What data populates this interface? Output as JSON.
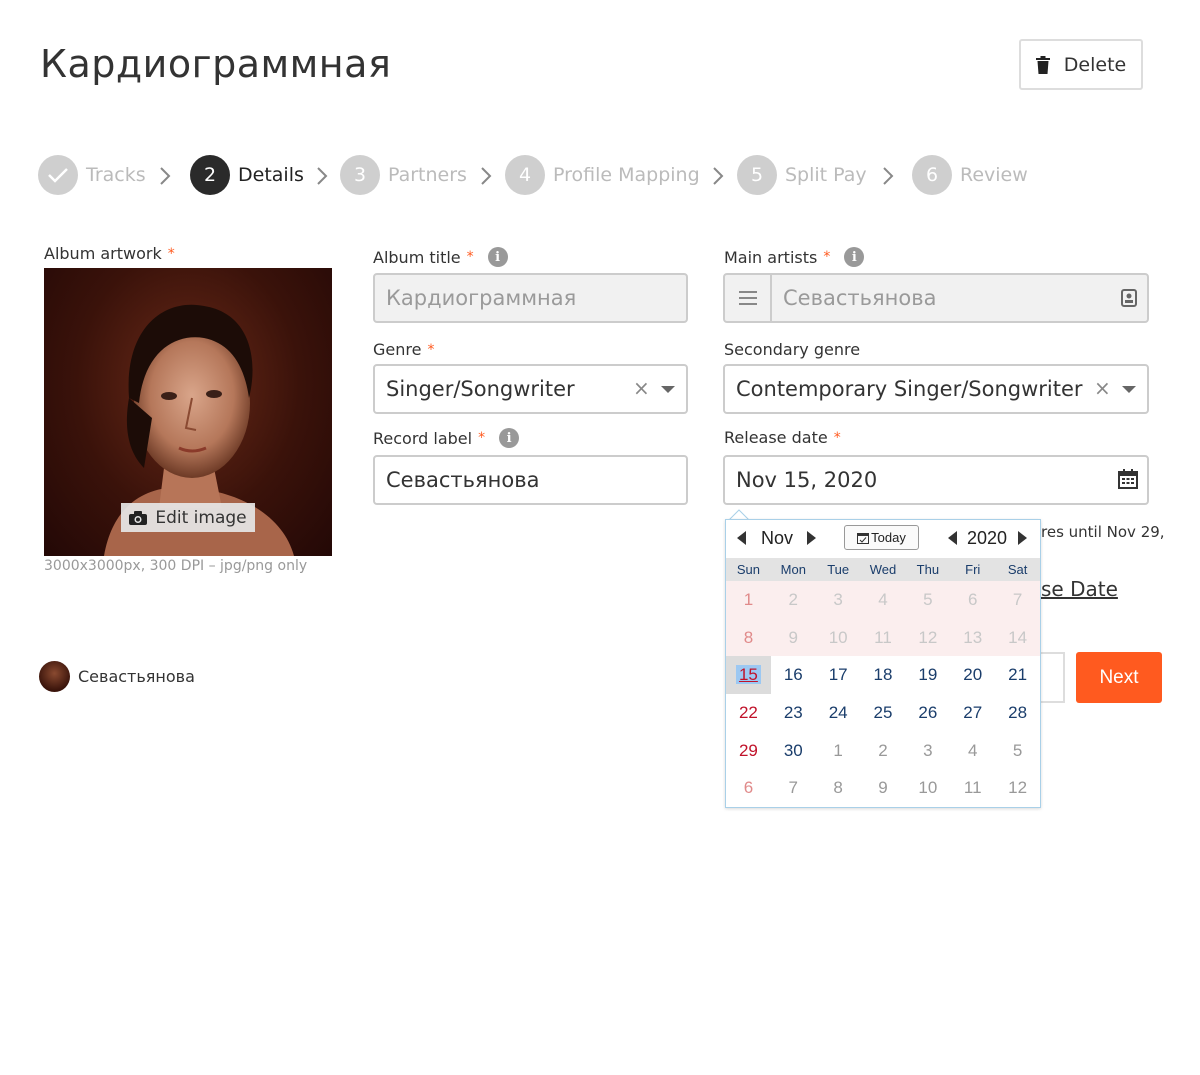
{
  "header": {
    "title": "Кардиограммная",
    "delete_label": "Delete"
  },
  "stepper": {
    "steps": [
      {
        "label": "Tracks",
        "number": "",
        "state": "done"
      },
      {
        "label": "Details",
        "number": "2",
        "state": "active"
      },
      {
        "label": "Partners",
        "number": "3",
        "state": "pending"
      },
      {
        "label": "Profile Mapping",
        "number": "4",
        "state": "pending"
      },
      {
        "label": "Split Pay",
        "number": "5",
        "state": "pending"
      },
      {
        "label": "Review",
        "number": "6",
        "state": "pending"
      }
    ]
  },
  "artwork": {
    "label": "Album artwork",
    "edit_label": "Edit image",
    "caption": "3000x3000px, 300 DPI – jpg/png only"
  },
  "form": {
    "album_title": {
      "label": "Album title",
      "value": "Кардиограммная"
    },
    "main_artists": {
      "label": "Main artists",
      "value": "Севастьянова"
    },
    "genre": {
      "label": "Genre",
      "value": "Singer/Songwriter"
    },
    "secondary_genre": {
      "label": "Secondary genre",
      "value": "Contemporary Singer/Songwriter"
    },
    "record_label": {
      "label": "Record label",
      "value": "Севастьянова"
    },
    "release_date": {
      "label": "Release date",
      "value": "Nov 15, 2020"
    }
  },
  "behind": {
    "note_fragment": "res until Nov 29,",
    "link_fragment": "se Date"
  },
  "actions": {
    "next_label": "Next"
  },
  "owner": {
    "name": "Севастьянова"
  },
  "calendar": {
    "month": "Nov",
    "year": "2020",
    "today_label": "Today",
    "weekdays": [
      "Sun",
      "Mon",
      "Tue",
      "Wed",
      "Thu",
      "Fri",
      "Sat"
    ],
    "weeks": [
      [
        {
          "d": "1",
          "t": "prev"
        },
        {
          "d": "2",
          "t": "prev"
        },
        {
          "d": "3",
          "t": "prev"
        },
        {
          "d": "4",
          "t": "prev"
        },
        {
          "d": "5",
          "t": "prev"
        },
        {
          "d": "6",
          "t": "prev"
        },
        {
          "d": "7",
          "t": "prev"
        }
      ],
      [
        {
          "d": "8",
          "t": "prev"
        },
        {
          "d": "9",
          "t": "prev"
        },
        {
          "d": "10",
          "t": "prev"
        },
        {
          "d": "11",
          "t": "prev"
        },
        {
          "d": "12",
          "t": "prev"
        },
        {
          "d": "13",
          "t": "prev"
        },
        {
          "d": "14",
          "t": "prev"
        }
      ],
      [
        {
          "d": "15",
          "t": "sel"
        },
        {
          "d": "16",
          "t": "cur"
        },
        {
          "d": "17",
          "t": "cur"
        },
        {
          "d": "18",
          "t": "cur"
        },
        {
          "d": "19",
          "t": "cur"
        },
        {
          "d": "20",
          "t": "cur"
        },
        {
          "d": "21",
          "t": "cur"
        }
      ],
      [
        {
          "d": "22",
          "t": "cur"
        },
        {
          "d": "23",
          "t": "cur"
        },
        {
          "d": "24",
          "t": "cur"
        },
        {
          "d": "25",
          "t": "cur"
        },
        {
          "d": "26",
          "t": "cur"
        },
        {
          "d": "27",
          "t": "cur"
        },
        {
          "d": "28",
          "t": "cur"
        }
      ],
      [
        {
          "d": "29",
          "t": "cur"
        },
        {
          "d": "30",
          "t": "cur"
        },
        {
          "d": "1",
          "t": "next"
        },
        {
          "d": "2",
          "t": "next"
        },
        {
          "d": "3",
          "t": "next"
        },
        {
          "d": "4",
          "t": "next"
        },
        {
          "d": "5",
          "t": "next"
        }
      ],
      [
        {
          "d": "6",
          "t": "next"
        },
        {
          "d": "7",
          "t": "next"
        },
        {
          "d": "8",
          "t": "next"
        },
        {
          "d": "9",
          "t": "next"
        },
        {
          "d": "10",
          "t": "next"
        },
        {
          "d": "11",
          "t": "next"
        },
        {
          "d": "12",
          "t": "next"
        }
      ]
    ]
  },
  "colors": {
    "accent": "#ff5a1f",
    "step_active": "#2a2a2a",
    "step_pending": "#cfcfcf",
    "cal_blue": "#1a3d6b",
    "cal_red": "#c0122a"
  },
  "icons": [
    "trash-icon",
    "check-icon",
    "chevron-right-icon",
    "info-icon",
    "camera-icon",
    "list-icon",
    "contact-card-icon",
    "calendar-icon",
    "clear-icon",
    "caret-down-icon"
  ]
}
